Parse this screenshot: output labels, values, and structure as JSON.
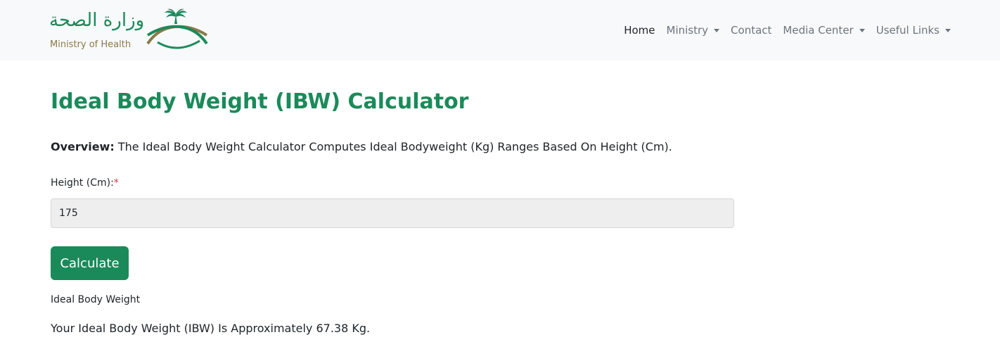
{
  "brand": {
    "arabic_name": "وزارة الصحة",
    "english_name": "Ministry of Health",
    "primary_color": "#1b8a5a",
    "gold_color": "#8a7a4a"
  },
  "nav": {
    "items": [
      {
        "label": "Home",
        "active": true,
        "dropdown": false
      },
      {
        "label": "Ministry",
        "active": false,
        "dropdown": true
      },
      {
        "label": "Contact",
        "active": false,
        "dropdown": false
      },
      {
        "label": "Media Center",
        "active": false,
        "dropdown": true
      },
      {
        "label": "Useful Links",
        "active": false,
        "dropdown": true
      }
    ]
  },
  "page": {
    "title": "Ideal Body Weight (IBW) Calculator",
    "overview_label": "Overview:",
    "overview_text": " The Ideal Body Weight Calculator Computes Ideal Bodyweight (Kg) Ranges Based On Height (Cm)."
  },
  "form": {
    "height_label": "Height (Cm):",
    "required_marker": "*",
    "height_value": "175",
    "calculate_label": "Calculate"
  },
  "result": {
    "heading": "Ideal Body Weight",
    "text": "Your Ideal Body Weight (IBW) Is Approximately 67.38 Kg."
  }
}
